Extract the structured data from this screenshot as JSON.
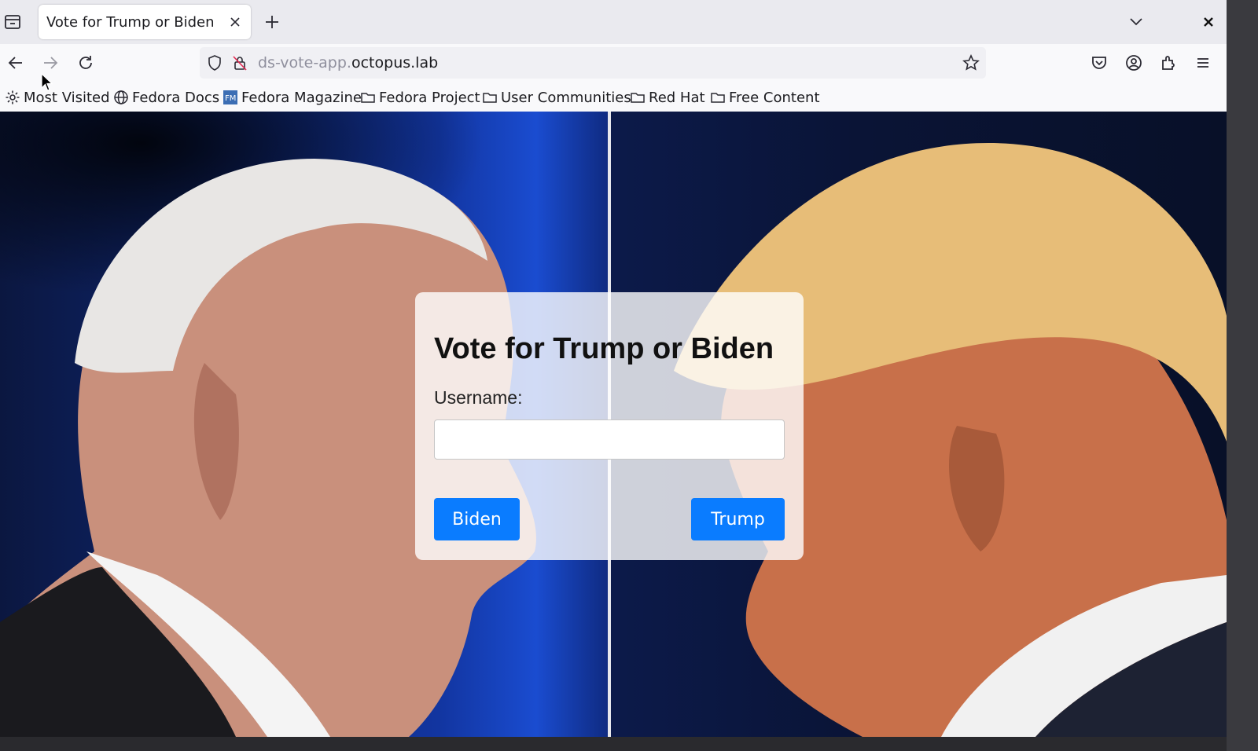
{
  "browser": {
    "tab": {
      "title": "Vote for Trump or Biden"
    },
    "url": {
      "prefix": "ds-vote-app.",
      "domain": "octopus.lab"
    },
    "bookmarks": [
      {
        "label": "Most Visited",
        "icon": "gear-icon"
      },
      {
        "label": "Fedora Docs",
        "icon": "globe-icon"
      },
      {
        "label": "Fedora Magazine",
        "icon": "fedora-magazine-icon"
      },
      {
        "label": "Fedora Project",
        "icon": "folder-icon"
      },
      {
        "label": "User Communities",
        "icon": "folder-icon"
      },
      {
        "label": "Red Hat",
        "icon": "folder-icon"
      },
      {
        "label": "Free Content",
        "icon": "folder-icon"
      }
    ]
  },
  "page": {
    "title": "Vote for Trump or Biden",
    "username_label": "Username:",
    "username_value": "",
    "biden_button": "Biden",
    "trump_button": "Trump"
  },
  "colors": {
    "button": "#0a7cff",
    "tab_strip": "#eaeaef",
    "toolbar": "#f9f9fb"
  }
}
